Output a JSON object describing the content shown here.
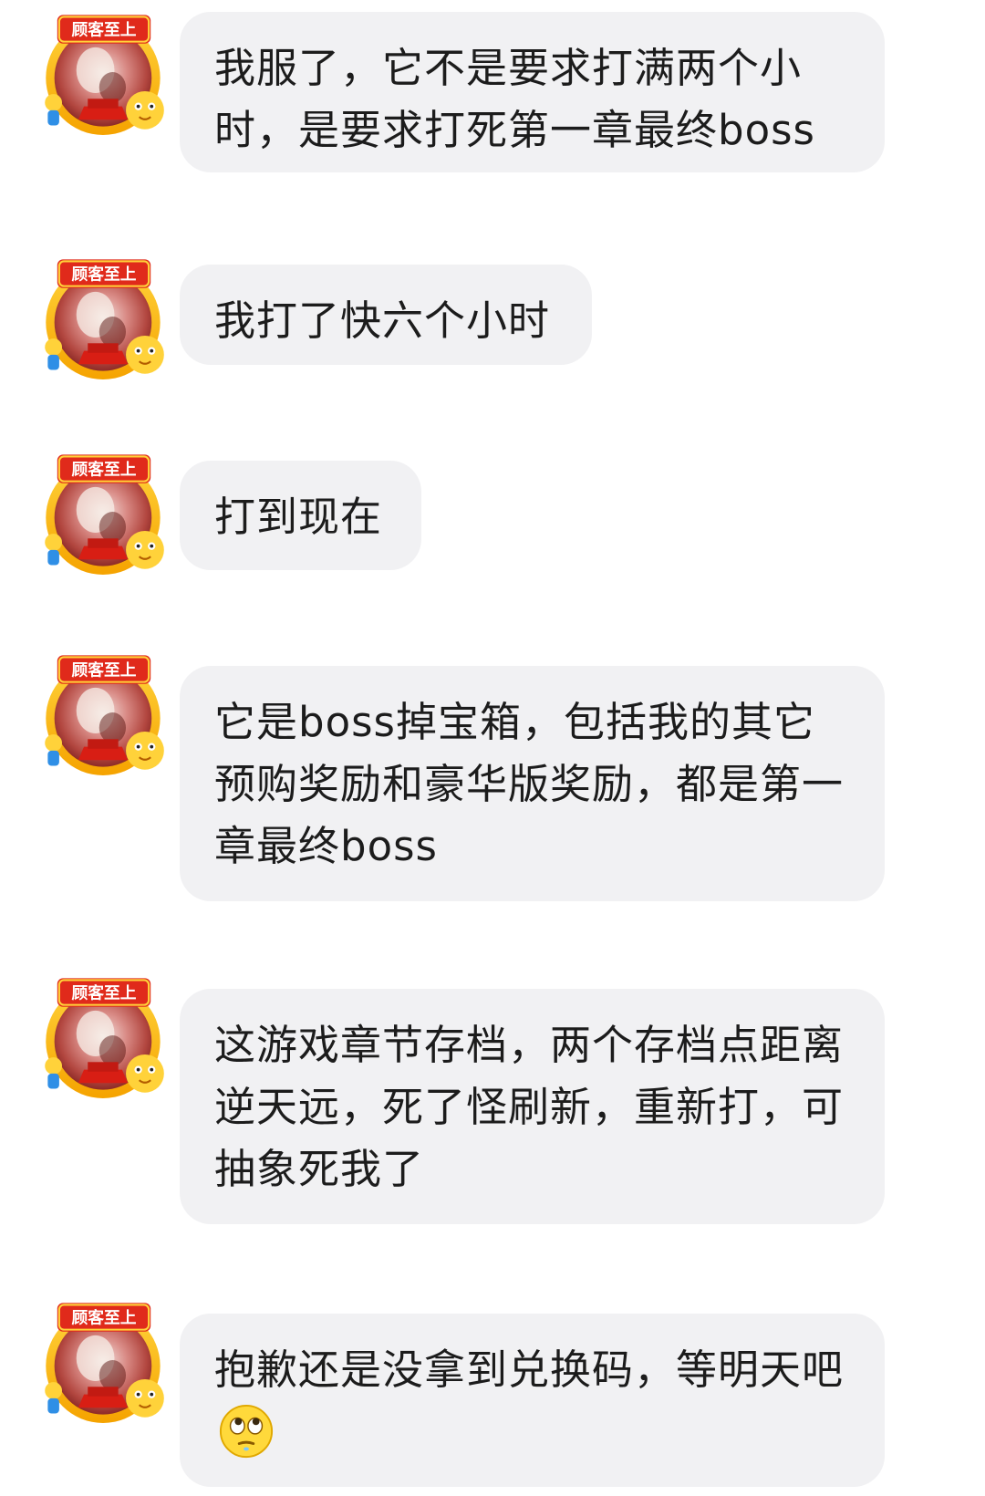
{
  "avatar": {
    "badge_text": "顾客至上",
    "icon": "customer-first-sticker-avatar"
  },
  "messages": [
    {
      "text": "我服了，它不是要求打满两个小时，是要求打死第一章最终boss"
    },
    {
      "text": "我打了快六个小时"
    },
    {
      "text": "打到现在"
    },
    {
      "text": "它是boss掉宝箱，包括我的其它预购奖励和豪华版奖励，都是第一章最终boss"
    },
    {
      "text": "这游戏章节存档，两个存档点距离逆天远，死了怪刷新，重新打，可抽象死我了"
    },
    {
      "text": "抱歉还是没拿到兑换码，等明天吧",
      "emoji": "rolling-eyes-emoji"
    }
  ],
  "colors": {
    "bubble_bg": "#f1f1f3",
    "text": "#1c1c1c",
    "page_bg": "#ffffff"
  }
}
